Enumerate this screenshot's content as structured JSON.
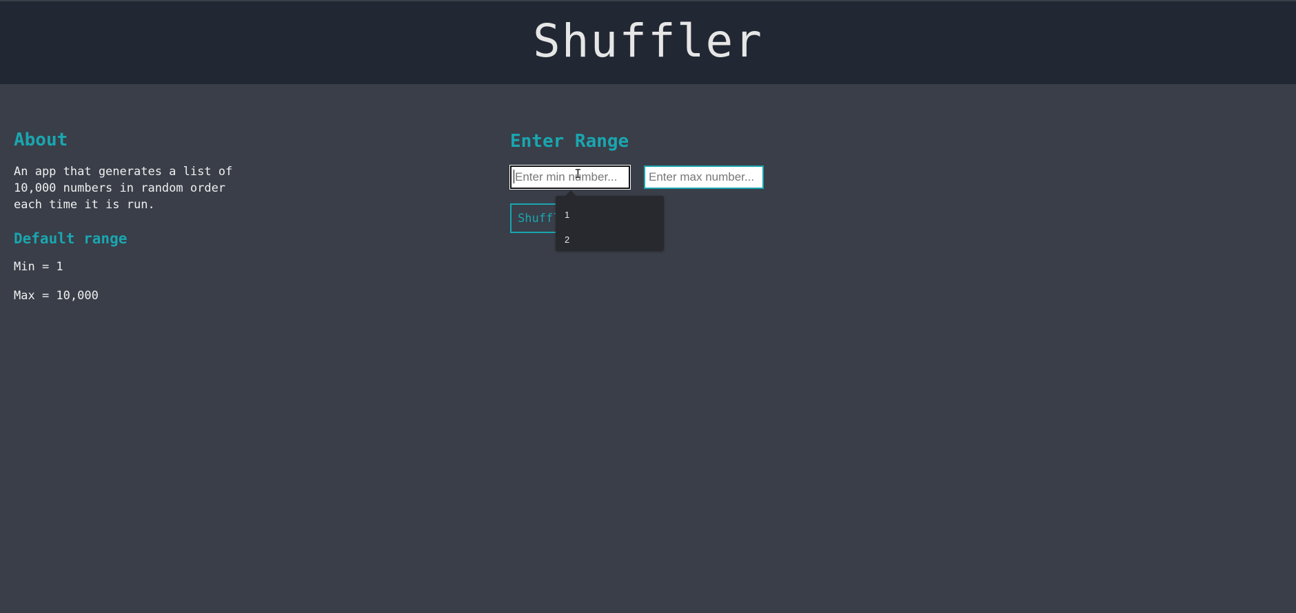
{
  "header": {
    "title": "Shuffler"
  },
  "about": {
    "heading": "About",
    "description": "An app that generates a list of\n10,000 numbers in random order\neach time it is run.",
    "default_heading": "Default range",
    "min_text": "Min = 1",
    "max_text": "Max = 10,000"
  },
  "range": {
    "heading": "Enter Range",
    "min_placeholder": "Enter min number...",
    "max_placeholder": "Enter max number...",
    "shuffle_label": "Shuffle",
    "suggestions": [
      "1",
      "2"
    ]
  },
  "colors": {
    "background": "#393e48",
    "header": "#222833",
    "accent": "#1aa6b0",
    "text": "#f0f0f0"
  }
}
